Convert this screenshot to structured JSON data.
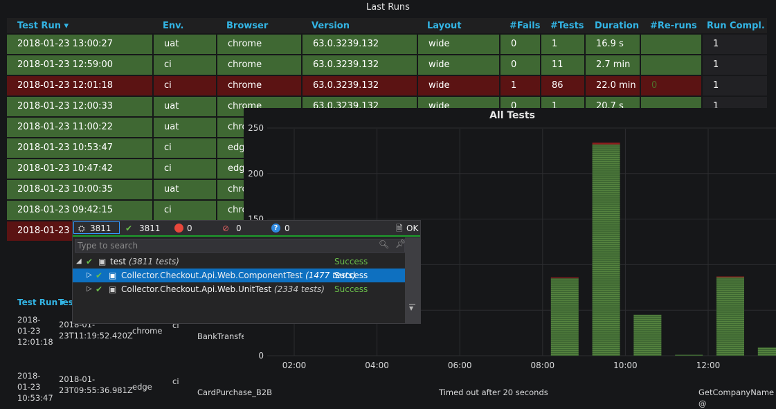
{
  "last_runs": {
    "title": "Last Runs",
    "headers": [
      "Test Run ▾",
      "Env.",
      "Browser",
      "Version",
      "Layout",
      "#Fails",
      "#Tests",
      "Duration",
      "#Re-runs",
      "Run Compl."
    ],
    "colors": {
      "pass": "#3f6833",
      "fail": "#5b1313",
      "header": "#33b5e5"
    },
    "rows": [
      {
        "status": "pass",
        "cells": [
          "2018-01-23 13:00:27",
          "uat",
          "chrome",
          "63.0.3239.132",
          "wide",
          "0",
          "1",
          "16.9 s",
          "",
          "1"
        ]
      },
      {
        "status": "pass",
        "cells": [
          "2018-01-23 12:59:00",
          "ci",
          "chrome",
          "63.0.3239.132",
          "wide",
          "0",
          "11",
          "2.7 min",
          "",
          "1"
        ]
      },
      {
        "status": "fail",
        "cells": [
          "2018-01-23 12:01:18",
          "ci",
          "chrome",
          "63.0.3239.132",
          "wide",
          "1",
          "86",
          "22.0 min",
          "0",
          "1"
        ]
      },
      {
        "status": "pass",
        "cells": [
          "2018-01-23 12:00:33",
          "uat",
          "chrome",
          "63.0.3239.132",
          "wide",
          "0",
          "1",
          "20.7 s",
          "",
          "1"
        ]
      },
      {
        "status": "pass",
        "cells": [
          "2018-01-23 11:00:22",
          "uat",
          "chrome",
          "",
          "",
          "",
          "",
          "",
          "",
          ""
        ]
      },
      {
        "status": "pass",
        "cells": [
          "2018-01-23 10:53:47",
          "ci",
          "edge",
          "",
          "",
          "",
          "",
          "",
          "",
          ""
        ]
      },
      {
        "status": "pass",
        "cells": [
          "2018-01-23 10:47:42",
          "ci",
          "edge",
          "",
          "",
          "",
          "",
          "",
          "",
          ""
        ]
      },
      {
        "status": "pass",
        "cells": [
          "2018-01-23 10:00:35",
          "uat",
          "chrome",
          "",
          "",
          "",
          "",
          "",
          "",
          ""
        ]
      },
      {
        "status": "pass",
        "cells": [
          "2018-01-23 09:42:15",
          "ci",
          "chrome",
          "",
          "",
          "",
          "",
          "",
          "",
          ""
        ]
      },
      {
        "status": "fail",
        "cells": [
          "2018-01-23 09",
          "",
          "",
          "",
          "",
          "",
          "",
          "",
          "",
          ""
        ]
      }
    ]
  },
  "details": {
    "headers": [
      "Test Run ▾",
      "Test"
    ],
    "rows": [
      {
        "run": "2018-\n01-23\n12:01:18",
        "ts": "2018-01-\n23T11:19:52.420Z",
        "browser": "chrome",
        "env": "ci",
        "test": "BankTransfer",
        "msg": "",
        "method": ""
      },
      {
        "run": "2018-\n01-23\n10:53:47",
        "ts": "2018-01-\n23T09:55:36.981Z",
        "browser": "edge",
        "env": "ci",
        "test": "CardPurchase_B2B",
        "msg": "Timed out after 20 seconds",
        "method": "GetCompanyName @"
      }
    ]
  },
  "all_tests": {
    "title": "All Tests",
    "chart_data": {
      "type": "bar",
      "title": "All Tests",
      "x_ticks": [
        "02:00",
        "04:00",
        "06:00",
        "08:00",
        "10:00",
        "12:00"
      ],
      "y_ticks": [
        "0",
        "50",
        "100",
        "150",
        "200",
        "250"
      ],
      "ylim": [
        0,
        250
      ],
      "series": [
        {
          "color": "#3f6833",
          "x": [
            "08:00",
            "09:00",
            "10:00",
            "11:00",
            "12:00",
            "13:00"
          ],
          "values": [
            85,
            232,
            45,
            1,
            86,
            9
          ]
        },
        {
          "color": "#8b1d1d",
          "x": [
            "08:00",
            "09:00",
            "10:00",
            "11:00",
            "12:00",
            "13:00"
          ],
          "values": [
            1,
            2,
            0,
            0,
            1,
            0
          ]
        }
      ],
      "grid": true
    }
  },
  "test_explorer": {
    "toolbar": {
      "total": "3811",
      "passed": "3811",
      "failed": "0",
      "skipped": "0",
      "inconclusive": "0",
      "ok_label": "OK"
    },
    "search_placeholder": "Type to search",
    "tree": [
      {
        "name": "test",
        "count": "(3811 tests)",
        "status": "Success",
        "level": 0,
        "expanded": true
      },
      {
        "name": "Collector.Checkout.Api.Web.ComponentTest",
        "count": "(1477 tests)",
        "status": "Success",
        "level": 1,
        "selected": true
      },
      {
        "name": "Collector.Checkout.Api.Web.UnitTest",
        "count": "(2334 tests)",
        "status": "Success",
        "level": 1
      }
    ]
  }
}
